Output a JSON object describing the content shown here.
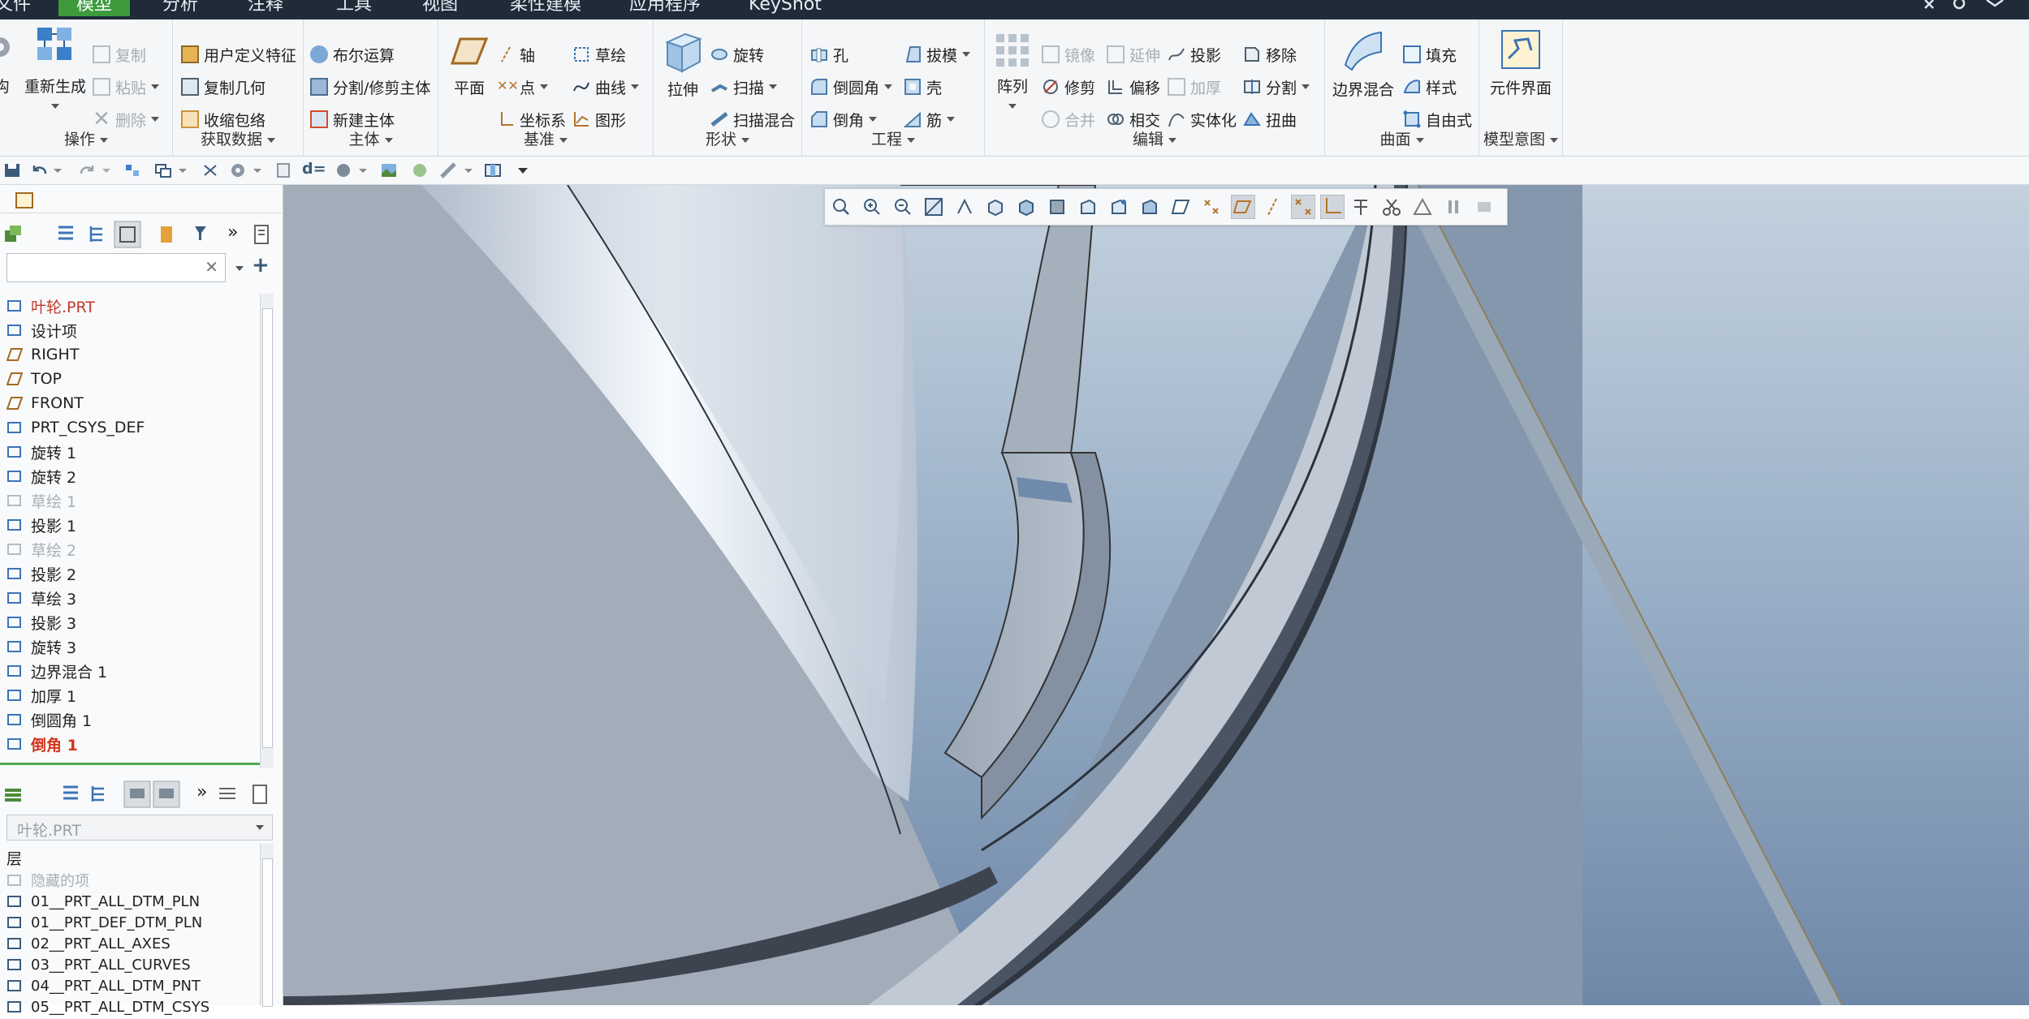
{
  "menubar": {
    "tabs": [
      "文件",
      "模型",
      "分析",
      "注释",
      "工具",
      "视图",
      "柔性建模",
      "应用程序",
      "KeyShot"
    ],
    "active_index": 1
  },
  "ribbon": {
    "operations": {
      "label": "操作",
      "regenerate": "重新生成",
      "copy": "复制",
      "paste": "粘贴",
      "delete": "删除",
      "truncated": "构"
    },
    "get_data": {
      "label": "获取数据",
      "udf": "用户定义特征",
      "copy_geom": "复制几何",
      "shrinkwrap": "收缩包络"
    },
    "body": {
      "label": "主体",
      "boolean": "布尔运算",
      "split_trim": "分割/修剪主体",
      "new_body": "新建主体"
    },
    "datum": {
      "label": "基准",
      "plane": "平面",
      "axis": "轴",
      "point": "点",
      "csys": "坐标系",
      "sketch": "草绘",
      "curve": "曲线",
      "graph": "图形"
    },
    "shapes": {
      "label": "形状",
      "extrude": "拉伸",
      "revolve": "旋转",
      "sweep": "扫描",
      "swept_blend": "扫描混合"
    },
    "engineering": {
      "label": "工程",
      "hole": "孔",
      "round": "倒圆角",
      "chamfer": "倒角",
      "draft": "拔模",
      "shell": "壳",
      "rib": "筋"
    },
    "editing": {
      "label": "编辑",
      "pattern": "阵列",
      "mirror": "镜像",
      "trim": "修剪",
      "merge": "合并",
      "extend": "延伸",
      "offset": "偏移",
      "intersect": "相交",
      "project": "投影",
      "thicken": "加厚",
      "solidify": "实体化",
      "remove": "移除",
      "split": "分割",
      "twist": "扭曲"
    },
    "surfaces": {
      "label": "曲面",
      "boundary_blend": "边界混合",
      "fill": "填充",
      "style": "样式",
      "freestyle": "自由式"
    },
    "model_intent": {
      "label": "模型意图",
      "component_interface": "元件界面"
    }
  },
  "qat": {
    "d_eq": "d="
  },
  "model_tree": {
    "search_placeholder": "",
    "items": [
      {
        "label": "叶轮.PRT",
        "state": "root"
      },
      {
        "label": "设计项",
        "state": "normal"
      },
      {
        "label": "RIGHT",
        "state": "normal"
      },
      {
        "label": "TOP",
        "state": "normal"
      },
      {
        "label": "FRONT",
        "state": "normal"
      },
      {
        "label": "PRT_CSYS_DEF",
        "state": "normal"
      },
      {
        "label": "旋转 1",
        "state": "normal"
      },
      {
        "label": "旋转 2",
        "state": "normal"
      },
      {
        "label": "草绘 1",
        "state": "dim"
      },
      {
        "label": "投影 1",
        "state": "normal"
      },
      {
        "label": "草绘 2",
        "state": "dim"
      },
      {
        "label": "投影 2",
        "state": "normal"
      },
      {
        "label": "草绘 3",
        "state": "normal"
      },
      {
        "label": "投影 3",
        "state": "normal"
      },
      {
        "label": "旋转 3",
        "state": "normal"
      },
      {
        "label": "边界混合 1",
        "state": "normal"
      },
      {
        "label": "加厚 1",
        "state": "normal"
      },
      {
        "label": "倒圆角 1",
        "state": "normal"
      },
      {
        "label": "倒角 1",
        "state": "error"
      }
    ]
  },
  "layer_tree": {
    "model_select": "叶轮.PRT",
    "header": "层",
    "items": [
      {
        "label": "隐藏的项",
        "state": "dim"
      },
      {
        "label": "01__PRT_ALL_DTM_PLN",
        "state": "normal"
      },
      {
        "label": "01__PRT_DEF_DTM_PLN",
        "state": "normal"
      },
      {
        "label": "02__PRT_ALL_AXES",
        "state": "normal"
      },
      {
        "label": "03__PRT_ALL_CURVES",
        "state": "normal"
      },
      {
        "label": "04__PRT_ALL_DTM_PNT",
        "state": "normal"
      },
      {
        "label": "05__PRT_ALL_DTM_CSYS",
        "state": "normal"
      }
    ]
  },
  "colors": {
    "accent_green": "#3d9b3d",
    "menubar": "#1f2b38",
    "error_red": "#d4351c",
    "root_red": "#c0392b"
  }
}
